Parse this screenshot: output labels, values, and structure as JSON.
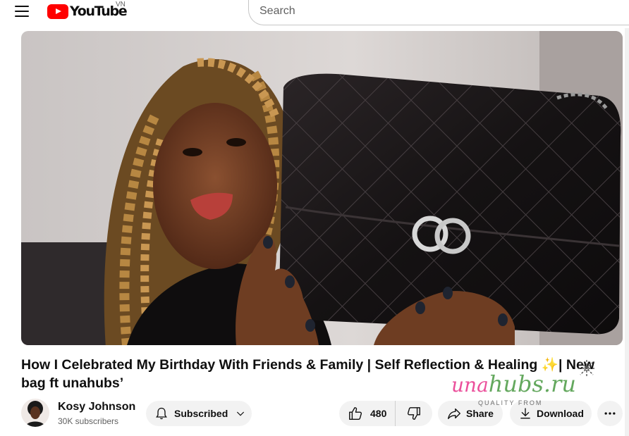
{
  "masthead": {
    "logo_text": "YouTube",
    "country_code": "VN",
    "search_placeholder": "Search"
  },
  "video": {
    "title": "How I Celebrated My Birthday With Friends & Family | Self Reflection & Healing ✨| New bag ft unahubs’"
  },
  "owner": {
    "channel_name": "Kosy Johnson",
    "subscriber_count": "30K subscribers",
    "subscribe_label": "Subscribed"
  },
  "actions": {
    "like_count": "480",
    "share_label": "Share",
    "download_label": "Download"
  },
  "watermark": {
    "brand_part1": "una",
    "brand_part2": "hubs.ru",
    "tagline": "QUALITY FROM"
  },
  "colors": {
    "brand_red": "#ff0000",
    "pill_background": "#f2f2f2",
    "text_primary": "#0f0f0f",
    "text_secondary": "#606060"
  },
  "icons": [
    "menu-icon",
    "youtube-logo-icon",
    "bell-icon",
    "chevron-down-icon",
    "thumbs-up-icon",
    "thumbs-down-icon",
    "share-icon",
    "download-icon",
    "more-icon",
    "sparkle-icon"
  ]
}
